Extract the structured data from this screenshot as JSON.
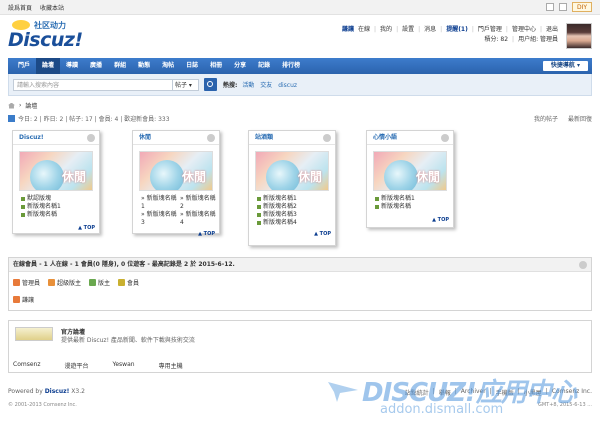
{
  "topbar": {
    "set_home": "設爲首頁",
    "bookmark": "收藏本站",
    "diy": "DIY"
  },
  "logo": {
    "cn": "社区动力",
    "en": "Discuz!"
  },
  "user": {
    "name": "謙讓",
    "status": "在線",
    "links": [
      "我的",
      "設置",
      "消息"
    ],
    "reminder": "提醒(1)",
    "admin": "門戶管理",
    "admin_center": "管理中心",
    "logout": "退出",
    "points": "積分: 82",
    "group": "用户組: 管理員"
  },
  "nav": {
    "items": [
      "門戶",
      "論壇",
      "導讀",
      "廣播",
      "群組",
      "動態",
      "淘帖",
      "日誌",
      "相冊",
      "分享",
      "記錄",
      "排行榜"
    ],
    "active_index": 1,
    "quick": "快捷導航"
  },
  "search": {
    "placeholder": "請輸入搜索內容",
    "type": "帖子",
    "hot_label": "熱搜:",
    "hot": [
      "活動",
      "交友",
      "discuz"
    ]
  },
  "crumb": {
    "current": "論壇"
  },
  "stats": {
    "text": "今日: 2 | 昨日: 2 | 帖子: 17 | 會員: 4 | 歡迎新會員: 333",
    "my_posts": "我的帖子",
    "latest": "最新回復"
  },
  "forums": [
    {
      "title": "Discuz!",
      "img_label": "休閒",
      "subs": [
        "默認版塊",
        "新版塊名稱1",
        "新版塊名稱"
      ],
      "grid": false,
      "top": "TOP"
    },
    {
      "title": "休閒",
      "img_label": "休閒",
      "subs": [
        "新版塊名稱1",
        "新版塊名稱2",
        "新版塊名稱3",
        "新版塊名稱4"
      ],
      "grid": true,
      "top": "TOP"
    },
    {
      "title": "站酒類",
      "img_label": "休閒",
      "subs": [
        "新版塊名稱1",
        "新版塊名稱2",
        "新版塊名稱3",
        "新版塊名稱4"
      ],
      "grid": false,
      "top": "TOP"
    },
    {
      "title": "心情小語",
      "img_label": "休閒",
      "subs": [
        "新版塊名稱1",
        "新版塊名稱"
      ],
      "grid": false,
      "top": "TOP"
    }
  ],
  "online": {
    "header": "在線會員 - 1 人在線 - 1 會員(0 隱身), 0 位遊客 - 最高記錄是 2 於 2015-6-12.",
    "legend": [
      "管理員",
      "超級版主",
      "版主",
      "會員"
    ],
    "legend_colors": [
      "#e87a3a",
      "#e8903a",
      "#6aa84f",
      "#c9b030"
    ],
    "user": "謙讓"
  },
  "friend": {
    "title": "官方論壇",
    "desc": "提供最新 Discuz! 產品新聞、軟件下載與技術交流",
    "links": [
      "Comsenz",
      "漫遊平台",
      "Yeswan",
      "專用主機"
    ]
  },
  "footer": {
    "powered": "Powered by",
    "brand": "Discuz!",
    "version": "X3.2",
    "copyright": "© 2001-2013 Comsenz Inc.",
    "right_links": [
      "站點統計",
      "舉報",
      "Archiver",
      "手機版",
      "小黑屋",
      "Comsenz Inc."
    ],
    "right_sub": "GMT+8, 2015-6-13 ..."
  },
  "watermark": {
    "brand": "DISCUZ!应用中心",
    "domain": "addon.dismall.com"
  }
}
